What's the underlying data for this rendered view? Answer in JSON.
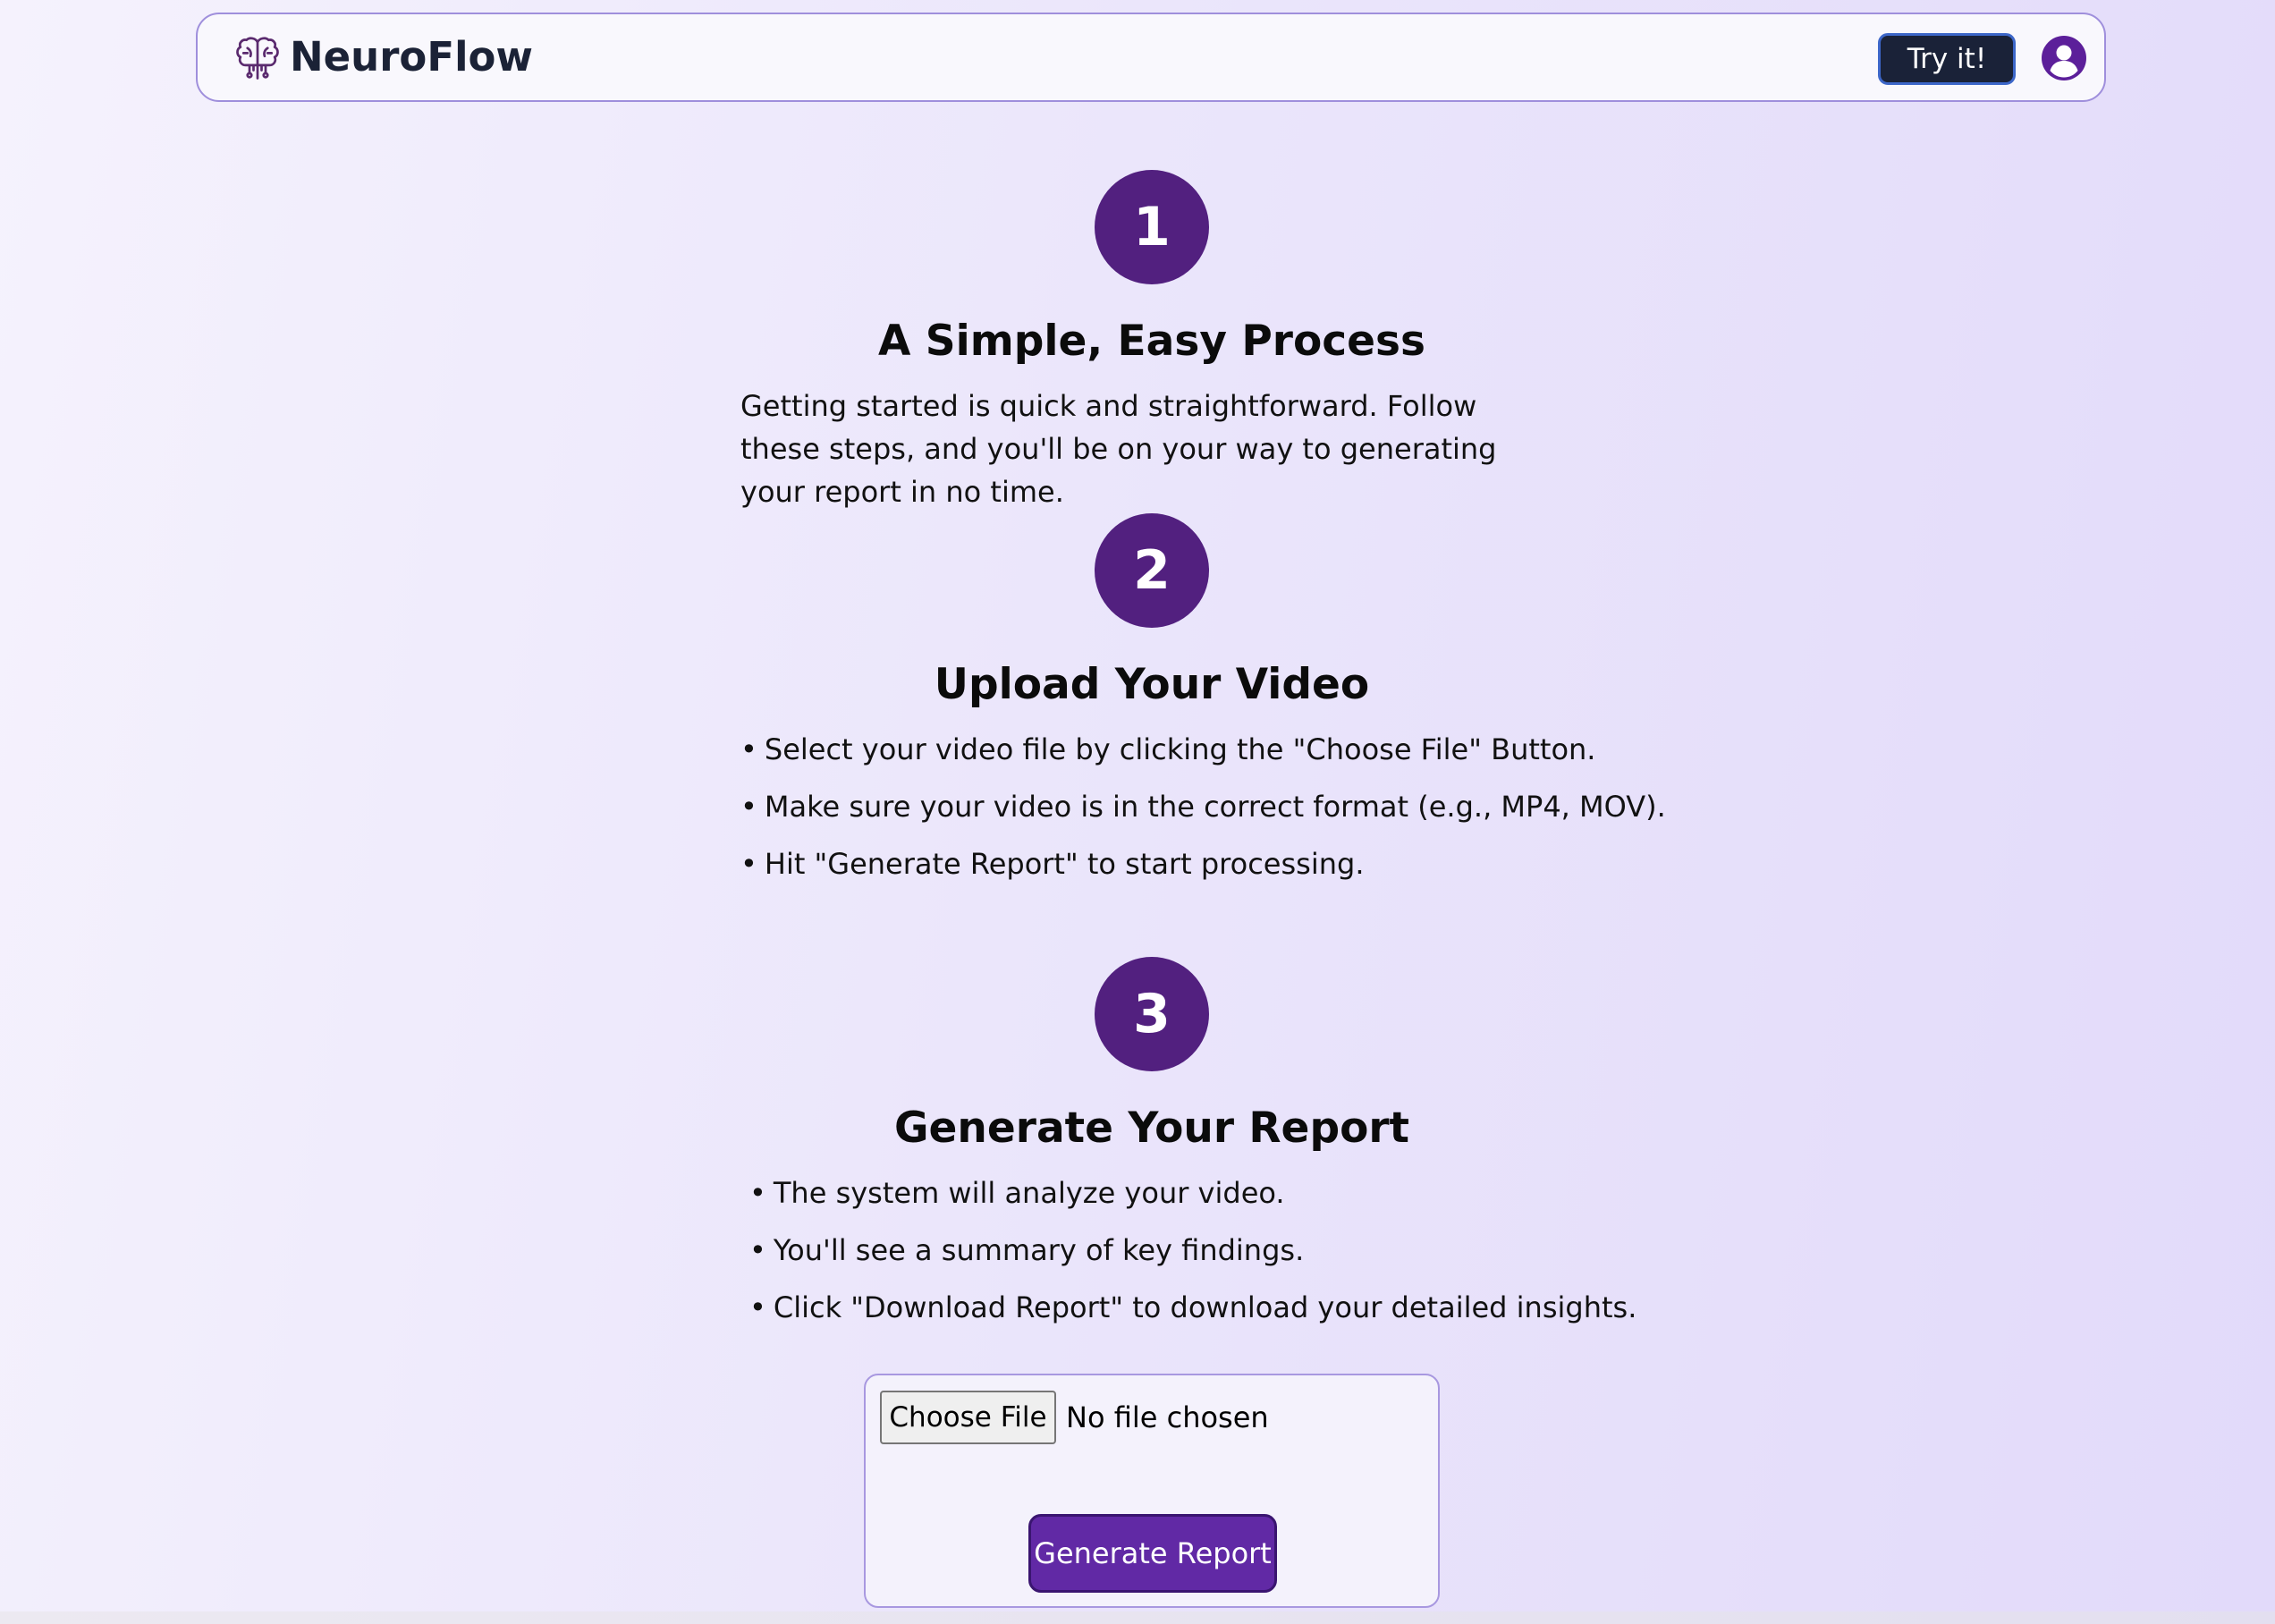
{
  "header": {
    "brand": "NeuroFlow",
    "brand_icon": "brain-circuit-icon",
    "try_label": "Try it!",
    "avatar_icon": "user-circle-icon"
  },
  "steps": [
    {
      "number": "1",
      "title": "A Simple, Easy Process",
      "text": "Getting started is quick and straightforward. Follow these steps, and you'll be on your way to generating your report in no time."
    },
    {
      "number": "2",
      "title": "Upload Your Video",
      "bullets": [
        "Select your video file by clicking the \"Choose File\" Button.",
        "Make sure your video is in the correct format (e.g., MP4, MOV).",
        "Hit \"Generate Report\" to start processing."
      ]
    },
    {
      "number": "3",
      "title": "Generate Your Report",
      "bullets": [
        "The system will analyze your video.",
        "You'll see a summary of key findings.",
        "Click \"Download Report\" to download your detailed insights."
      ]
    }
  ],
  "upload": {
    "choose_label": "Choose File",
    "file_status": "No file chosen",
    "generate_label": "Generate Report"
  },
  "colors": {
    "accent": "#52207f",
    "button": "#6129a5",
    "nav_button": "#1a2238",
    "border": "#9f8fdc"
  }
}
